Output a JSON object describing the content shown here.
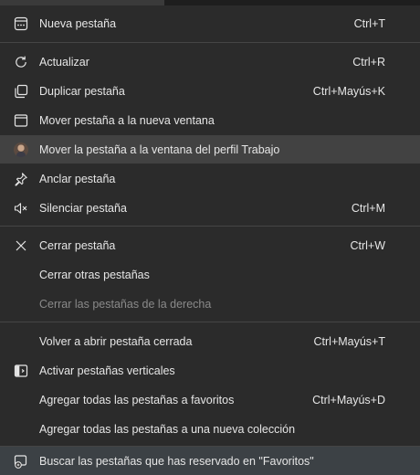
{
  "menu": {
    "items": [
      {
        "label": "Nueva pestaña",
        "shortcut": "Ctrl+T",
        "icon": "new-tab-icon"
      },
      {
        "label": "Actualizar",
        "shortcut": "Ctrl+R",
        "icon": "refresh-icon"
      },
      {
        "label": "Duplicar pestaña",
        "shortcut": "Ctrl+Mayús+K",
        "icon": "duplicate-tab-icon"
      },
      {
        "label": "Mover pestaña a la nueva ventana",
        "shortcut": "",
        "icon": "new-window-icon"
      },
      {
        "label": "Mover la pestaña a la ventana del perfil Trabajo",
        "shortcut": "",
        "icon": "profile-avatar"
      },
      {
        "label": "Anclar pestaña",
        "shortcut": "",
        "icon": "pin-icon"
      },
      {
        "label": "Silenciar pestaña",
        "shortcut": "Ctrl+M",
        "icon": "mute-icon"
      },
      {
        "label": "Cerrar pestaña",
        "shortcut": "Ctrl+W",
        "icon": "close-icon"
      },
      {
        "label": "Cerrar otras pestañas",
        "shortcut": ""
      },
      {
        "label": "Cerrar las pestañas de la derecha",
        "shortcut": "",
        "disabled": true
      },
      {
        "label": "Volver a abrir pestaña cerrada",
        "shortcut": "Ctrl+Mayús+T"
      },
      {
        "label": "Activar pestañas verticales",
        "shortcut": "",
        "icon": "vertical-tabs-icon"
      },
      {
        "label": "Agregar todas las pestañas a favoritos",
        "shortcut": "Ctrl+Mayús+D"
      },
      {
        "label": "Agregar todas las pestañas a una nueva colección",
        "shortcut": ""
      },
      {
        "label": "Buscar las pestañas que has reservado en \"Favoritos\"",
        "shortcut": "",
        "icon": "search-tabs-icon"
      }
    ]
  },
  "colors": {
    "background": "#2b2b2b",
    "hover": "#424242",
    "separator": "#454545",
    "text": "#e6e6e6",
    "disabled_text": "#8a8a8a"
  }
}
